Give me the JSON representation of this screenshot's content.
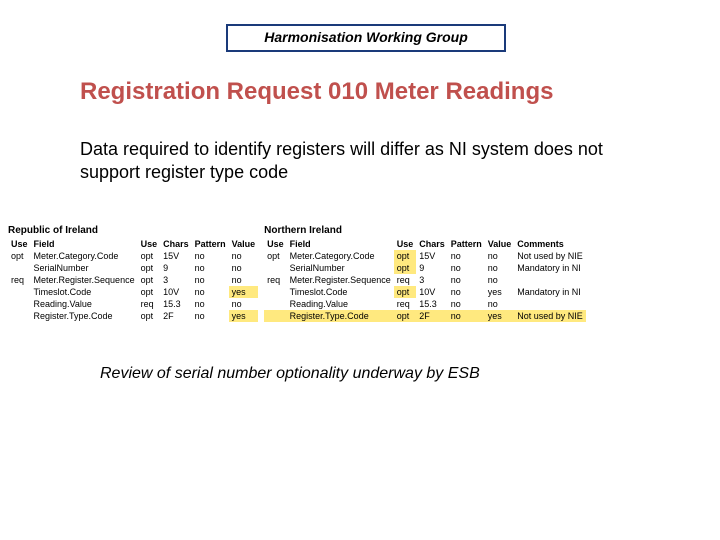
{
  "header": {
    "group": "Harmonisation Working Group"
  },
  "title": "Registration Request 010 Meter Readings",
  "intro": "Data required to identify registers will differ as NI system does not support register type code",
  "left": {
    "region": "Republic of Ireland",
    "cols": {
      "use": "Use",
      "field": "Field",
      "use2": "Use",
      "chars": "Chars",
      "pattern": "Pattern",
      "value": "Value"
    },
    "rows": [
      {
        "use": "opt",
        "field": "Meter.Category.Code",
        "use2": "opt",
        "chars": "15V",
        "pattern": "no",
        "value": "no",
        "hl": false
      },
      {
        "use": "",
        "field": "SerialNumber",
        "use2": "opt",
        "chars": "9",
        "pattern": "no",
        "value": "no",
        "hl": false
      },
      {
        "use": "req",
        "field": "Meter.Register.Sequence",
        "use2": "opt",
        "chars": "3",
        "pattern": "no",
        "value": "no",
        "hl": false
      },
      {
        "use": "",
        "field": "Timeslot.Code",
        "use2": "opt",
        "chars": "10V",
        "pattern": "no",
        "value": "yes",
        "hl": true
      },
      {
        "use": "",
        "field": "Reading.Value",
        "use2": "req",
        "chars": "15.3",
        "pattern": "no",
        "value": "no",
        "hl": false
      },
      {
        "use": "",
        "field": "Register.Type.Code",
        "use2": "opt",
        "chars": "2F",
        "pattern": "no",
        "value": "yes",
        "hl": true
      }
    ]
  },
  "right": {
    "region": "Northern Ireland",
    "cols": {
      "use": "Use",
      "field": "Field",
      "use2": "Use",
      "chars": "Chars",
      "pattern": "Pattern",
      "value": "Value",
      "comments": "Comments"
    },
    "rows": [
      {
        "use": "opt",
        "field": "Meter.Category.Code",
        "use2": "opt",
        "chars": "15V",
        "pattern": "no",
        "value": "no",
        "comments": "Not used by NIE",
        "hl": false,
        "use2hl": true
      },
      {
        "use": "",
        "field": "SerialNumber",
        "use2": "opt",
        "chars": "9",
        "pattern": "no",
        "value": "no",
        "comments": "Mandatory in NI",
        "hl": false,
        "use2hl": true
      },
      {
        "use": "req",
        "field": "Meter.Register.Sequence",
        "use2": "req",
        "chars": "3",
        "pattern": "no",
        "value": "no",
        "comments": "",
        "hl": false,
        "use2hl": false
      },
      {
        "use": "",
        "field": "Timeslot.Code",
        "use2": "opt",
        "chars": "10V",
        "pattern": "no",
        "value": "yes",
        "comments": "Mandatory in NI",
        "hl": false,
        "use2hl": true
      },
      {
        "use": "",
        "field": "Reading.Value",
        "use2": "req",
        "chars": "15.3",
        "pattern": "no",
        "value": "no",
        "comments": "",
        "hl": false,
        "use2hl": false
      },
      {
        "use": "",
        "field": "Register.Type.Code",
        "use2": "opt",
        "chars": "2F",
        "pattern": "no",
        "value": "yes",
        "comments": "Not used by NIE",
        "hl": true,
        "use2hl": true
      }
    ]
  },
  "footer": "Review of serial number optionality underway by ESB"
}
